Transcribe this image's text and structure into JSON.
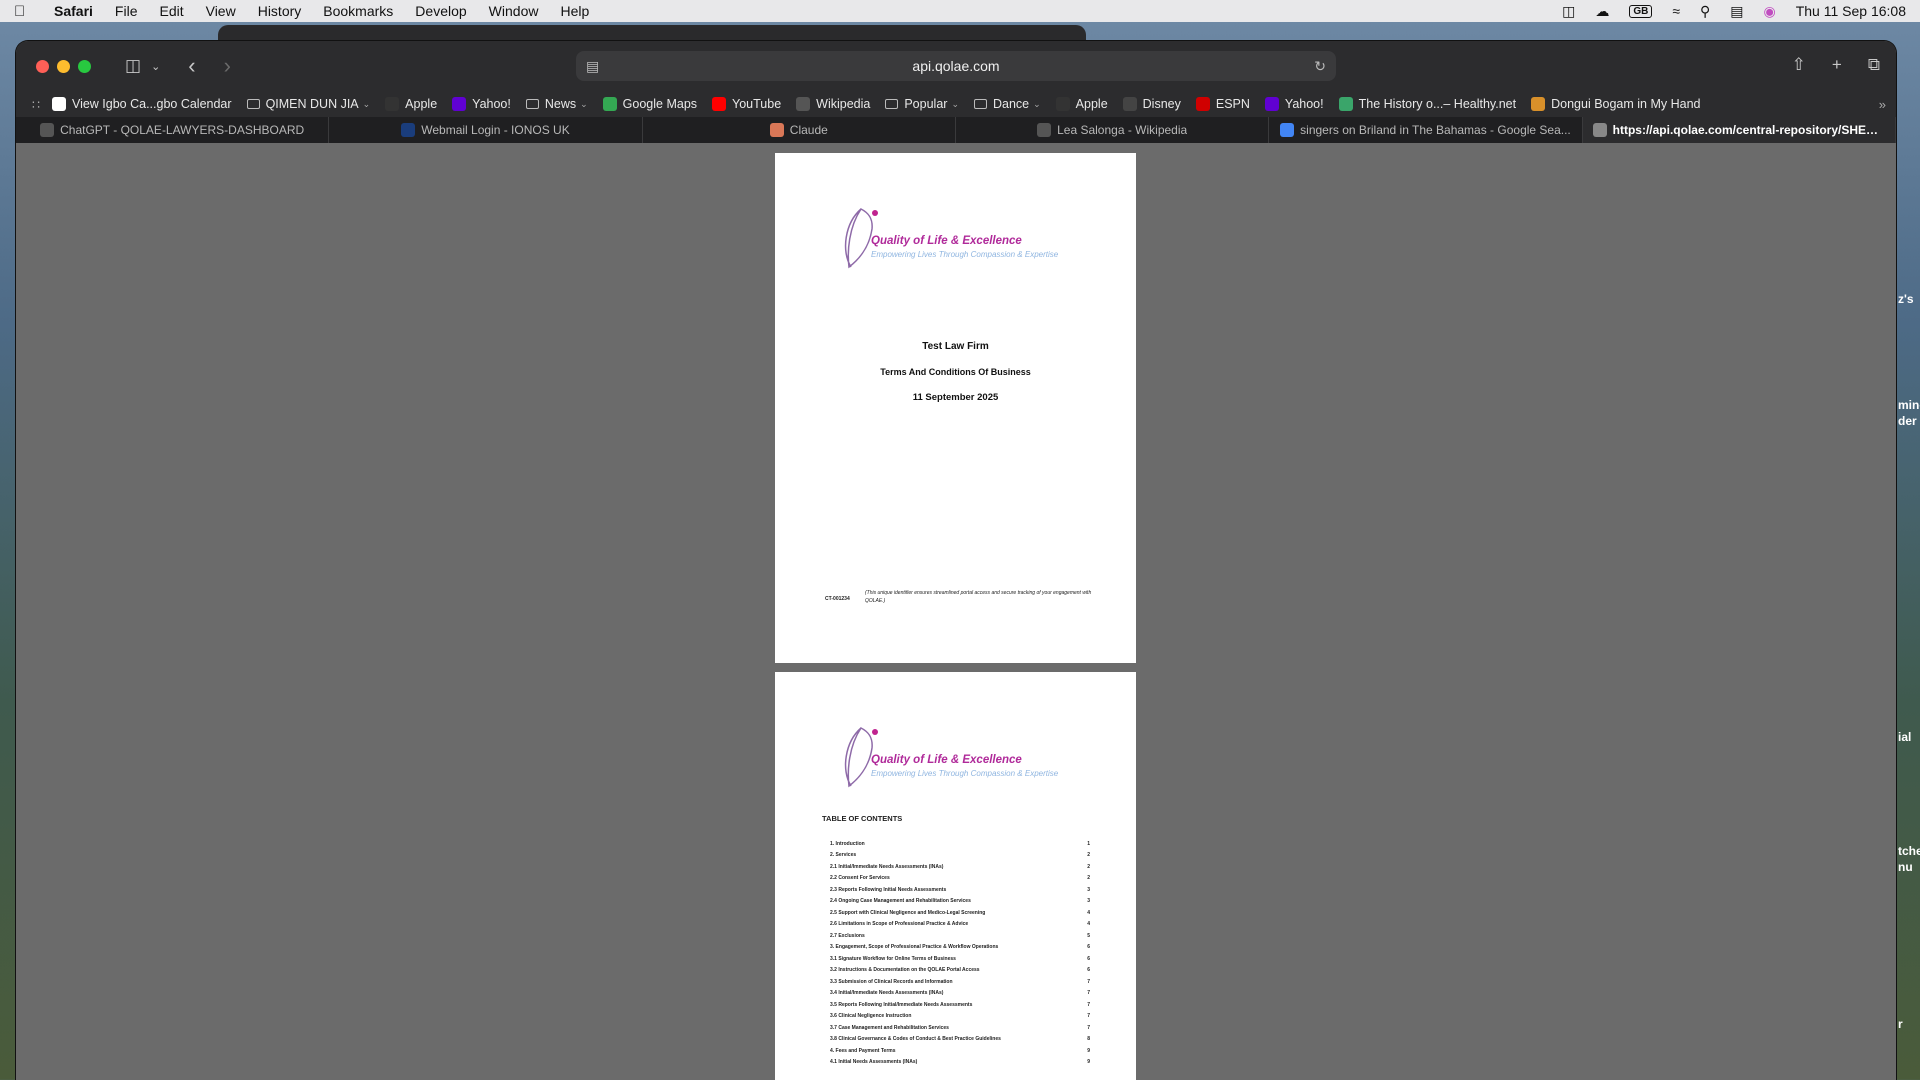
{
  "menubar": {
    "app": "Safari",
    "items": [
      "File",
      "Edit",
      "View",
      "History",
      "Bookmarks",
      "Develop",
      "Window",
      "Help"
    ],
    "input_source": "GB",
    "clock": "Thu 11 Sep  16:08"
  },
  "toolbar": {
    "url": "api.qolae.com"
  },
  "favorites": [
    {
      "label": "View Igbo Ca...gbo Calendar",
      "icon": "igbo-calendar-icon",
      "color": "#ffffff",
      "folder": false,
      "chevron": false
    },
    {
      "label": "QIMEN DUN JIA",
      "icon": "folder-icon",
      "folder": true,
      "chevron": true
    },
    {
      "label": "Apple",
      "icon": "apple-icon",
      "color": "#333333",
      "folder": false,
      "chevron": false
    },
    {
      "label": "Yahoo!",
      "icon": "yahoo-icon",
      "color": "#6001d2",
      "folder": false,
      "chevron": false
    },
    {
      "label": "News",
      "icon": "folder-icon",
      "folder": true,
      "chevron": true
    },
    {
      "label": "Google Maps",
      "icon": "google-maps-icon",
      "color": "#34a853",
      "folder": false,
      "chevron": false
    },
    {
      "label": "YouTube",
      "icon": "youtube-icon",
      "color": "#ff0000",
      "folder": false,
      "chevron": false
    },
    {
      "label": "Wikipedia",
      "icon": "wikipedia-icon",
      "color": "#555555",
      "folder": false,
      "chevron": false
    },
    {
      "label": "Popular",
      "icon": "folder-icon",
      "folder": true,
      "chevron": true
    },
    {
      "label": "Dance",
      "icon": "folder-icon",
      "folder": true,
      "chevron": true
    },
    {
      "label": "Apple",
      "icon": "apple-icon",
      "color": "#333333",
      "folder": false,
      "chevron": false
    },
    {
      "label": "Disney",
      "icon": "disney-icon",
      "color": "#444444",
      "folder": false,
      "chevron": false
    },
    {
      "label": "ESPN",
      "icon": "espn-icon",
      "color": "#d00000",
      "folder": false,
      "chevron": false
    },
    {
      "label": "Yahoo!",
      "icon": "yahoo-icon",
      "color": "#6001d2",
      "folder": false,
      "chevron": false
    },
    {
      "label": "The History o...– Healthy.net",
      "icon": "healthy-net-icon",
      "color": "#3aa56a",
      "folder": false,
      "chevron": false
    },
    {
      "label": "Dongui Bogam in My Hand",
      "icon": "dongui-bogam-icon",
      "color": "#d8902a",
      "folder": false,
      "chevron": false
    }
  ],
  "tabs": [
    {
      "label": "ChatGPT - QOLAE-LAWYERS-DASHBOARD",
      "icon": "chatgpt-icon",
      "color": "#555555",
      "active": false
    },
    {
      "label": "Webmail Login - IONOS UK",
      "icon": "ionos-icon",
      "color": "#1a3d7c",
      "active": false
    },
    {
      "label": "Claude",
      "icon": "claude-icon",
      "color": "#d97757",
      "active": false
    },
    {
      "label": "Lea Salonga - Wikipedia",
      "icon": "wikipedia-icon",
      "color": "#555555",
      "active": false
    },
    {
      "label": "singers on Briland  in The Bahamas - Google Sea...",
      "icon": "google-icon",
      "color": "#4285f4",
      "active": false
    },
    {
      "label": "https://api.qolae.com/central-repository/SHEET_...",
      "icon": "qolae-icon",
      "color": "#888888",
      "active": true
    }
  ],
  "document": {
    "logo_title": "Quality of Life & Excellence",
    "logo_subtitle": "Empowering Lives Through Compassion & Expertise",
    "firm": "Test Law Firm",
    "terms_title": "Terms And Conditions Of Business",
    "date": "11 September 2025",
    "identifier": "CT-001234",
    "identifier_note": "(This unique identifier ensures streamlined portal access and secure tracking of your engagement with QOLAE.)",
    "toc_title": "TABLE OF CONTENTS",
    "toc": [
      {
        "title": "1. Introduction",
        "page": "1"
      },
      {
        "title": "2. Services",
        "page": "2"
      },
      {
        "title": "2.1 Initial/Immediate Needs Assessments (INAs)",
        "page": "2"
      },
      {
        "title": "2.2 Consent For Services",
        "page": "2"
      },
      {
        "title": "2.3 Reports Following Initial Needs Assessments",
        "page": "3"
      },
      {
        "title": "2.4 Ongoing Case Management and Rehabilitation Services",
        "page": "3"
      },
      {
        "title": "2.5 Support with Clinical Negligence and Medico-Legal Screening",
        "page": "4"
      },
      {
        "title": "2.6 Limitations in Scope of Professional Practice & Advice",
        "page": "4"
      },
      {
        "title": "2.7 Exclusions",
        "page": "5"
      },
      {
        "title": "3. Engagement, Scope of Professional Practice & Workflow Operations",
        "page": "6"
      },
      {
        "title": "3.1 Signature Workflow for Online Terms of Business",
        "page": "6"
      },
      {
        "title": "3.2 Instructions & Documentation on the QOLAE Portal Access",
        "page": "6"
      },
      {
        "title": "3.3 Submission of Clinical Records and Information",
        "page": "7"
      },
      {
        "title": "3.4 Initial/Immediate Needs Assessments (INAs)",
        "page": "7"
      },
      {
        "title": "3.5 Reports Following Initial/Immediate Needs Assessments",
        "page": "7"
      },
      {
        "title": "3.6 Clinical Negligence Instruction",
        "page": "7"
      },
      {
        "title": "3.7 Case Management and Rehabilitation Services",
        "page": "7"
      },
      {
        "title": "3.8 Clinical Governance & Codes of Conduct & Best Practice Guidelines",
        "page": "8"
      },
      {
        "title": "4. Fees and Payment Terms",
        "page": "9"
      },
      {
        "title": "4.1 Initial Needs Assessments (INAs)",
        "page": "9"
      }
    ]
  },
  "desktop": {
    "fragments": [
      "z's",
      "min-",
      "der",
      "ial",
      "tche",
      "nu",
      "r"
    ]
  }
}
